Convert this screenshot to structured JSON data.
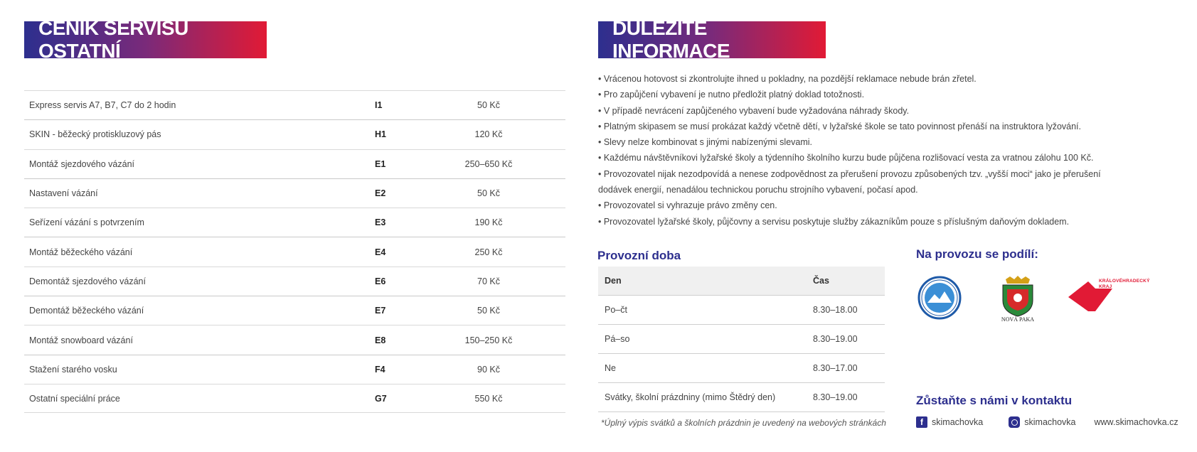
{
  "left": {
    "title": "CENÍK SERVISU OSTATNÍ",
    "rows": [
      {
        "name": "Express servis A7, B7, C7 do 2 hodin",
        "code": "I1",
        "price": "50 Kč"
      },
      {
        "name": "SKIN - běžecký protiskluzový pás",
        "code": "H1",
        "price": "120 Kč"
      },
      {
        "name": "Montáž sjezdového vázání",
        "code": "E1",
        "price": "250–650 Kč"
      },
      {
        "name": "Nastavení vázání",
        "code": "E2",
        "price": "50 Kč"
      },
      {
        "name": "Seřízení vázání s potvrzením",
        "code": "E3",
        "price": "190 Kč"
      },
      {
        "name": "Montáž běžeckého vázání",
        "code": "E4",
        "price": "250 Kč"
      },
      {
        "name": "Demontáž sjezdového vázání",
        "code": "E6",
        "price": "70 Kč"
      },
      {
        "name": "Demontáž běžeckého vázání",
        "code": "E7",
        "price": "50 Kč"
      },
      {
        "name": "Montáž snowboard vázání",
        "code": "E8",
        "price": "150–250 Kč"
      },
      {
        "name": "Stažení starého vosku",
        "code": "F4",
        "price": "90 Kč"
      },
      {
        "name": "Ostatní speciální práce",
        "code": "G7",
        "price": "550 Kč"
      }
    ]
  },
  "right": {
    "title": "DŮLEŽITÉ INFORMACE",
    "info": [
      "• Vrácenou hotovost si zkontrolujte ihned u pokladny, na pozdější reklamace nebude brán zřetel.",
      "• Pro zapůjčení vybavení je nutno předložit platný doklad totožnosti.",
      "• V případě nevrácení zapůjčeného vybavení bude vyžadována náhrady škody.",
      "• Platným skipasem se musí prokázat každý včetně dětí, v lyžařské škole se tato povinnost přenáší na instruktora lyžování.",
      "• Slevy nelze kombinovat s jinými nabízenými slevami.",
      "• Každému návštěvníkovi lyžařské školy a týdenního školního kurzu bude půjčena rozlišovací vesta za vratnou zálohu 100 Kč.",
      "• Provozovatel nijak nezodpovídá a nenese zodpovědnost za přerušení provozu způsobených tzv. „vyšší moci“ jako je přerušení",
      "dodávek energií, nenadálou technickou poruchu strojního vybavení, počasí apod.",
      "• Provozovatel si vyhrazuje právo změny cen.",
      "• Provozovatel lyžařské školy, půjčovny a servisu poskytuje služby zákazníkům pouze s příslušným daňovým dokladem."
    ],
    "hours": {
      "title": "Provozní doba",
      "head": {
        "day": "Den",
        "time": "Čas"
      },
      "rows": [
        {
          "day": "Po–čt",
          "time": "8.30–18.00"
        },
        {
          "day": "Pá–so",
          "time": "8.30–19.00"
        },
        {
          "day": "Ne",
          "time": "8.30–17.00"
        },
        {
          "day": "Svátky, školní prázdniny (mimo Štědrý den)",
          "time": "8.30–19.00"
        }
      ],
      "footnote": "*Úplný výpis svátků a školních prázdnin je uvedený na webových stránkách"
    },
    "partners": {
      "title": "Na provozu se podílí:",
      "logos": [
        {
          "icon": "ski-club-nova-paka-logo",
          "text": "LYŽAŘSKÝ KLUB NOVÁ PAKA"
        },
        {
          "icon": "nova-paka-coat-of-arms",
          "text": "NOVÁ PAKA"
        },
        {
          "icon": "kralovehradecky-kraj-logo",
          "text": "KRÁLOVÉHRADECKÝ KRAJ"
        }
      ]
    },
    "contact": {
      "title": "Zůstaňte s námi v kontaktu",
      "facebook": "skimachovka",
      "instagram": "skimachovka",
      "web": "www.skimachovka.cz"
    }
  },
  "colors": {
    "brand_blue": "#2d2f8e",
    "brand_red": "#e11a35"
  }
}
